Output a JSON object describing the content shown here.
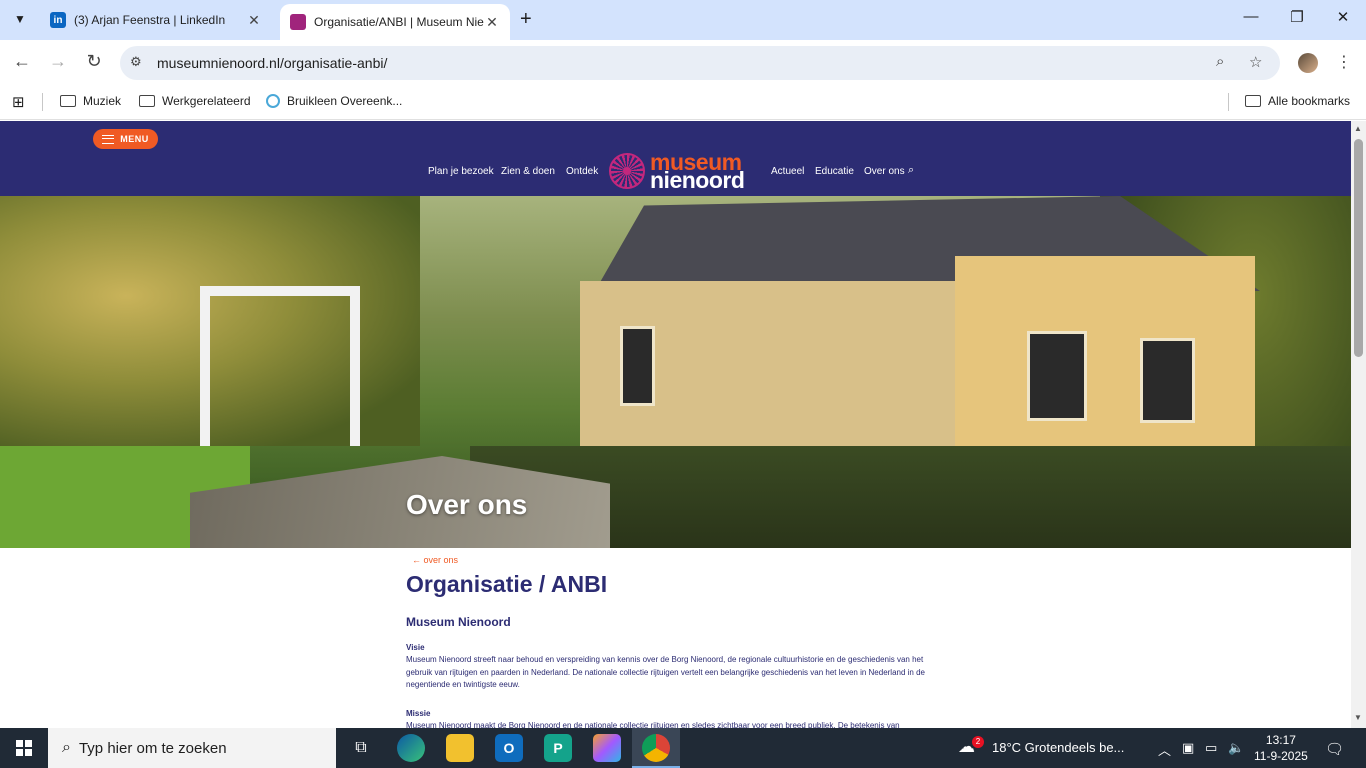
{
  "browser": {
    "tabs": [
      {
        "title": "(3) Arjan Feenstra | LinkedIn",
        "active": false,
        "icon": "linkedin-icon"
      },
      {
        "title": "Organisatie/ANBI | Museum Nienoord",
        "active": true,
        "icon": "museum-nienoord-icon"
      }
    ],
    "url": "museumnienoord.nl/organisatie-anbi/",
    "bookmarks": [
      "Muziek",
      "Werkgerelateerd",
      "Bruikleen Overeenk..."
    ],
    "all_bookmarks": "Alle bookmarks"
  },
  "site": {
    "menu_label": "MENU",
    "nav": [
      "Plan je bezoek",
      "Zien & doen",
      "Ontdek",
      "Actueel",
      "Educatie",
      "Over ons"
    ],
    "logo_line1": "museum",
    "logo_line2": "nienoord",
    "hero_title": "Over ons",
    "back_link": "← over ons",
    "page_title": "Organisatie / ANBI",
    "section_title": "Museum Nienoord",
    "visie_label": "Visie",
    "visie_text": "Museum Nienoord streeft naar behoud en verspreiding van kennis over de Borg Nienoord, de regionale cultuurhistorie en de geschiedenis van het gebruik van rijtuigen en paarden in Nederland. De nationale collectie rijtuigen vertelt een belangrijke geschiedenis van het leven in Nederland in de negentiende en twintigste eeuw.",
    "missie_label": "Missie",
    "missie_text": "Museum Nienoord maakt de Borg Nienoord en de nationale collectie rijtuigen en sledes zichtbaar voor een breed publiek. De betekenis van"
  },
  "taskbar": {
    "search_placeholder": "Typ hier om te zoeken",
    "weather": "18°C  Grotendeels be...",
    "weather_badge": "2",
    "time": "13:17",
    "date": "11-9-2025"
  },
  "colors": {
    "site_navy": "#2c2c73",
    "site_orange": "#f05a24",
    "logo_magenta": "#c3277d"
  }
}
